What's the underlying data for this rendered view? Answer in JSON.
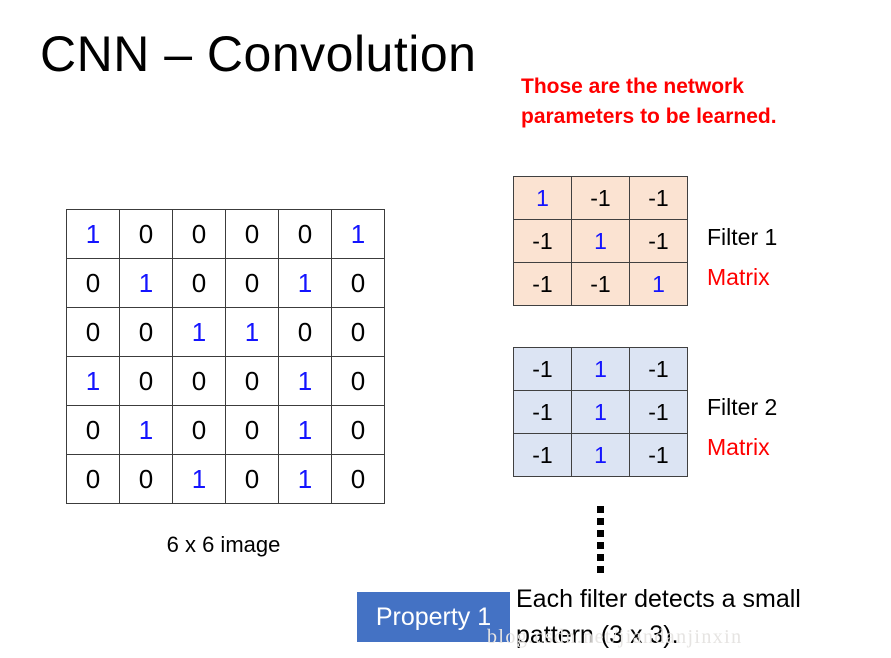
{
  "slide": {
    "title": "CNN – Convolution",
    "watermark": "blog.csdn.net/jiandanjinxin"
  },
  "network_note": {
    "line1": "Those are the network",
    "line2": "parameters to be learned.",
    "color": "#FF0000"
  },
  "input_image": {
    "caption": "6 x 6 image",
    "rows": [
      [
        "1",
        "0",
        "0",
        "0",
        "0",
        "1"
      ],
      [
        "0",
        "1",
        "0",
        "0",
        "1",
        "0"
      ],
      [
        "0",
        "0",
        "1",
        "1",
        "0",
        "0"
      ],
      [
        "1",
        "0",
        "0",
        "0",
        "1",
        "0"
      ],
      [
        "0",
        "1",
        "0",
        "0",
        "1",
        "0"
      ],
      [
        "0",
        "0",
        "1",
        "0",
        "1",
        "0"
      ]
    ]
  },
  "filters": [
    {
      "name": "Filter 1",
      "matrix_label": "Matrix",
      "bg_color": "#FBE3D2",
      "rows": [
        [
          "1",
          "-1",
          "-1"
        ],
        [
          "-1",
          "1",
          "-1"
        ],
        [
          "-1",
          "-1",
          "1"
        ]
      ]
    },
    {
      "name": "Filter 2",
      "matrix_label": "Matrix",
      "bg_color": "#DCE4F3",
      "rows": [
        [
          "-1",
          "1",
          "-1"
        ],
        [
          "-1",
          "1",
          "-1"
        ],
        [
          "-1",
          "1",
          "-1"
        ]
      ]
    }
  ],
  "property": {
    "badge": "Property 1",
    "badge_color": "#4472C4",
    "line1": "Each filter detects a small",
    "line2": "pattern (3 x 3)."
  },
  "colors": {
    "one_value": "#1414FF",
    "zero_value": "#000000",
    "accent_red": "#FF0000"
  }
}
